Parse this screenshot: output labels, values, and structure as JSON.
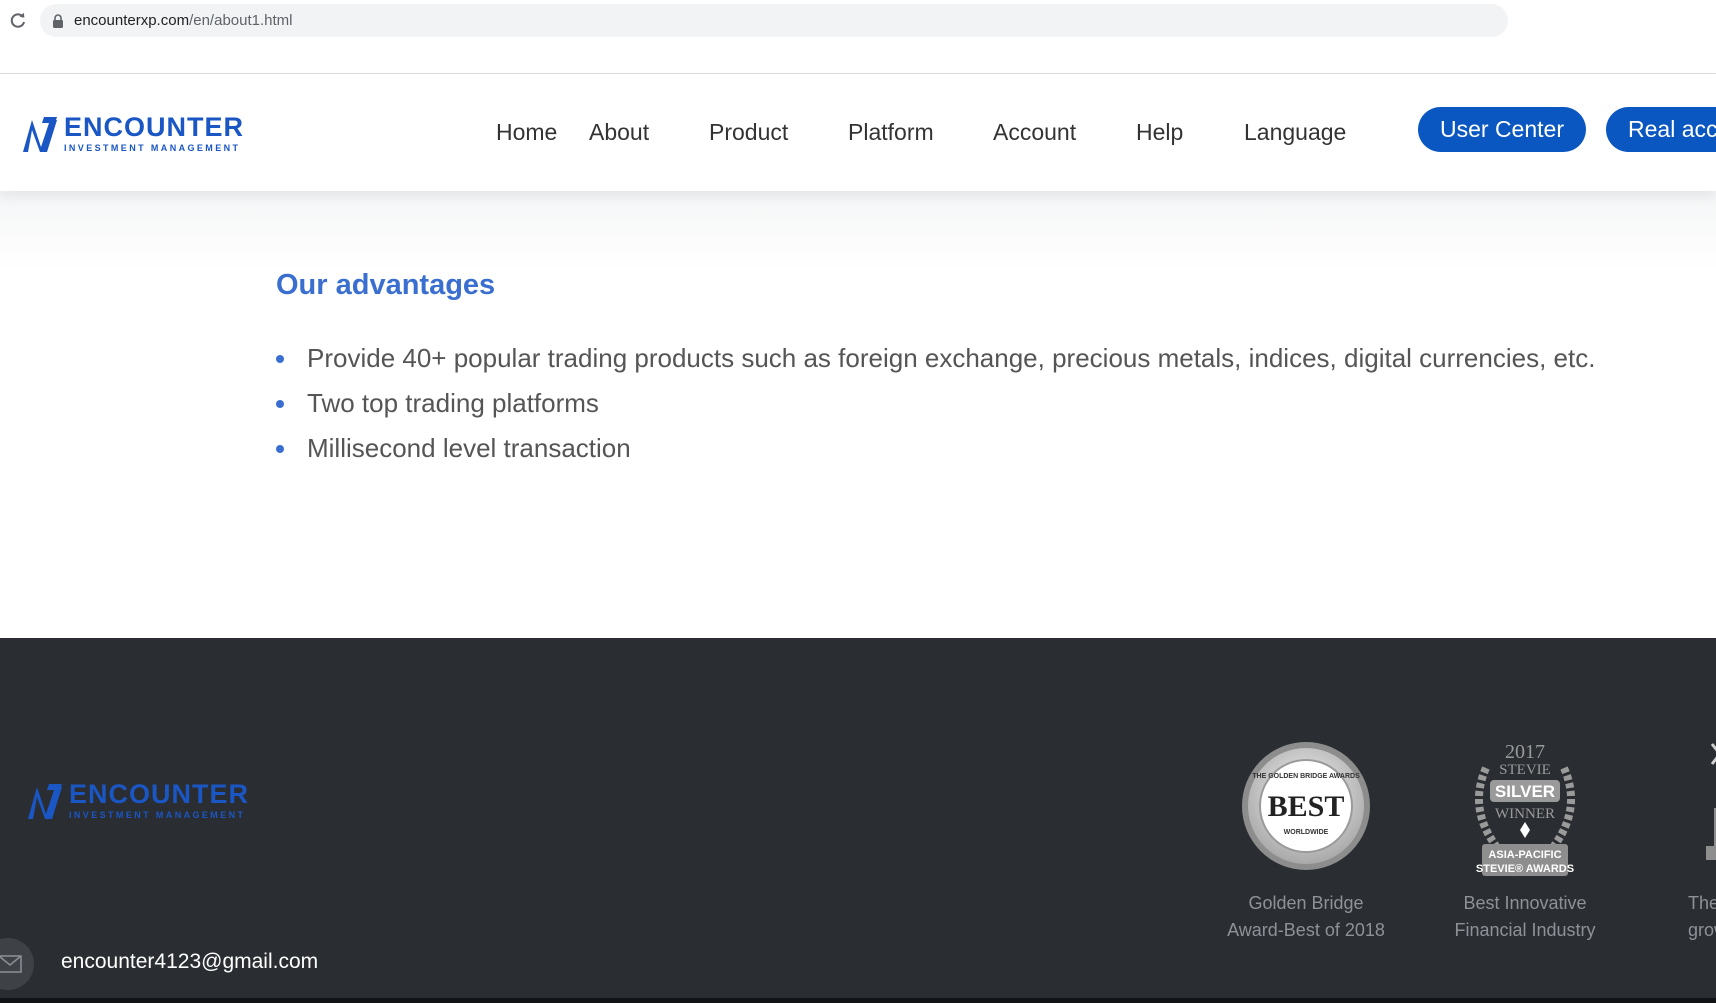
{
  "browser": {
    "url_domain": "encounterxp.com",
    "url_path": "/en/about1.html"
  },
  "header": {
    "logo": {
      "name": "ENCOUNTER",
      "tagline": "INVESTMENT MANAGEMENT"
    },
    "nav": {
      "home": "Home",
      "about": "About",
      "product": "Product",
      "platform": "Platform",
      "account": "Account",
      "help": "Help",
      "language": "Language"
    },
    "buttons": {
      "user_center": "User Center",
      "real_account": "Real acc"
    }
  },
  "main": {
    "title": "Our advantages",
    "advantages": [
      "Provide 40+ popular trading products such as foreign exchange, precious metals, indices, digital currencies, etc.",
      "Two top trading platforms",
      "Millisecond level transaction"
    ]
  },
  "footer": {
    "logo": {
      "name": "ENCOUNTER",
      "tagline": "INVESTMENT MANAGEMENT"
    },
    "awards": [
      {
        "badge": {
          "top": "THE GOLDEN BRIDGE AWARDS",
          "main": "BEST",
          "bottom": "WORLDWIDE"
        },
        "caption_line1": "Golden Bridge",
        "caption_line2": "Award-Best of 2018"
      },
      {
        "badge": {
          "year": "2017",
          "brand": "STEVIE",
          "medal": "SILVER",
          "status": "WINNER",
          "region_line1": "ASIA-PACIFIC",
          "region_line2": "STEVIE® AWARDS"
        },
        "caption_line1": "Best Innovative",
        "caption_line2": "Financial Industry"
      },
      {
        "caption_line1": "The",
        "caption_line2": "growin"
      }
    ],
    "email": "encounter4123@gmail.com"
  },
  "colors": {
    "brand_blue": "#1a56c4",
    "button_blue": "#0a57c2",
    "title_blue": "#3a6fd0",
    "footer_bg": "#2a2d31"
  }
}
